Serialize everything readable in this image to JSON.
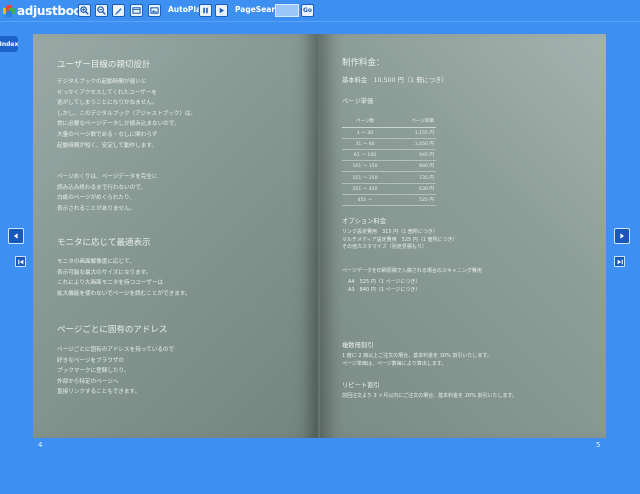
{
  "app": {
    "logo_text": "adjustbook"
  },
  "toolbar": {
    "autoplay_label": "AutoPlay",
    "pagesearch_label": "PageSearch",
    "search_value": "",
    "go_label": "Go"
  },
  "index_tab": {
    "label": "Index"
  },
  "left_page": {
    "page_number": "4",
    "sections": [
      {
        "heading": "ユーザー目線の親切設計",
        "paragraphs": [
          [
            "デジタルブックの起動時間が遅いと",
            "せっかくアクセスしてくれたユーザーを",
            "逃がしてしまうことになりかねません。",
            "しかし、このデジタルブック（アジャストブック）は、",
            "常に必要なページデータしか読み込まないので、",
            "大量のページ数である・なしに関わらず",
            "起動時間が短く、安定して動作します。"
          ],
          [
            "ページめくりは、ページデータを完全に",
            "読み込み終わるまで行わないので、",
            "白紙のページがめくられたり、",
            "表示されることがありません。"
          ]
        ]
      },
      {
        "heading": "モニタに応じて最適表示",
        "paragraphs": [
          [
            "モニタの画面解像度に応じて、",
            "表示可能な最大のサイズになります。",
            "これにより大画面モニタを持つユーザーは",
            "拡大機能を使わないでページを読むことができます。"
          ]
        ]
      },
      {
        "heading": "ページごとに固有のアドレス",
        "paragraphs": [
          [
            "ページごとに固有のアドレスを持っているので",
            "好きなページをブラウザの",
            "ブックマークに登録したり、",
            "外部から特定のページへ",
            "直接リンクすることもできます。"
          ]
        ]
      }
    ]
  },
  "right_page": {
    "page_number": "5",
    "title": "制作料金：",
    "base_fee": "基本料金　10,500 円（1 冊につき）",
    "unit_price_heading": "ページ単価",
    "table": {
      "headers": [
        "ページ数",
        "ページ単価"
      ],
      "rows": [
        [
          "1 〜 30",
          "1,155 円"
        ],
        [
          "31 〜 60",
          "1,050 円"
        ],
        [
          "61 〜 100",
          "945 円"
        ],
        [
          "101 〜 150",
          "840 円"
        ],
        [
          "151 〜 250",
          "735 円"
        ],
        [
          "251 〜 450",
          "630 円"
        ],
        [
          "451 〜",
          "525 円"
        ]
      ]
    },
    "options_heading": "オプション料金",
    "options": [
      "リンク設定費用　315 円（1 箇所につき）",
      "マルチメディア設定費用　525 円（1 箇所につき）",
      "その他カスタマイズ（別途見積もり）"
    ],
    "scan_note": "ページデータを印刷原稿で入稿される場合のスキャニング費用",
    "scan_rows": [
      "A4　525 円（1 ページにつき）",
      "A3　840 円（1 ページにつき）"
    ],
    "multi_discount_heading": "複数冊割引",
    "multi_discount_lines": [
      "1 度に 2 冊以上ご注文の場合、基本料金を 30% 割引いたします。",
      "ページ単価は、ページ数毎により算出します。"
    ],
    "repeat_discount_heading": "リピート割引",
    "repeat_discount_lines": [
      "前回注文より 3 ヶ月以内にご注文の場合、基本料金を 20% 割引いたします。"
    ]
  },
  "colors": {
    "background": "#3d8ff2",
    "page": "#8a9b96",
    "nav_button": "#1858b8"
  }
}
